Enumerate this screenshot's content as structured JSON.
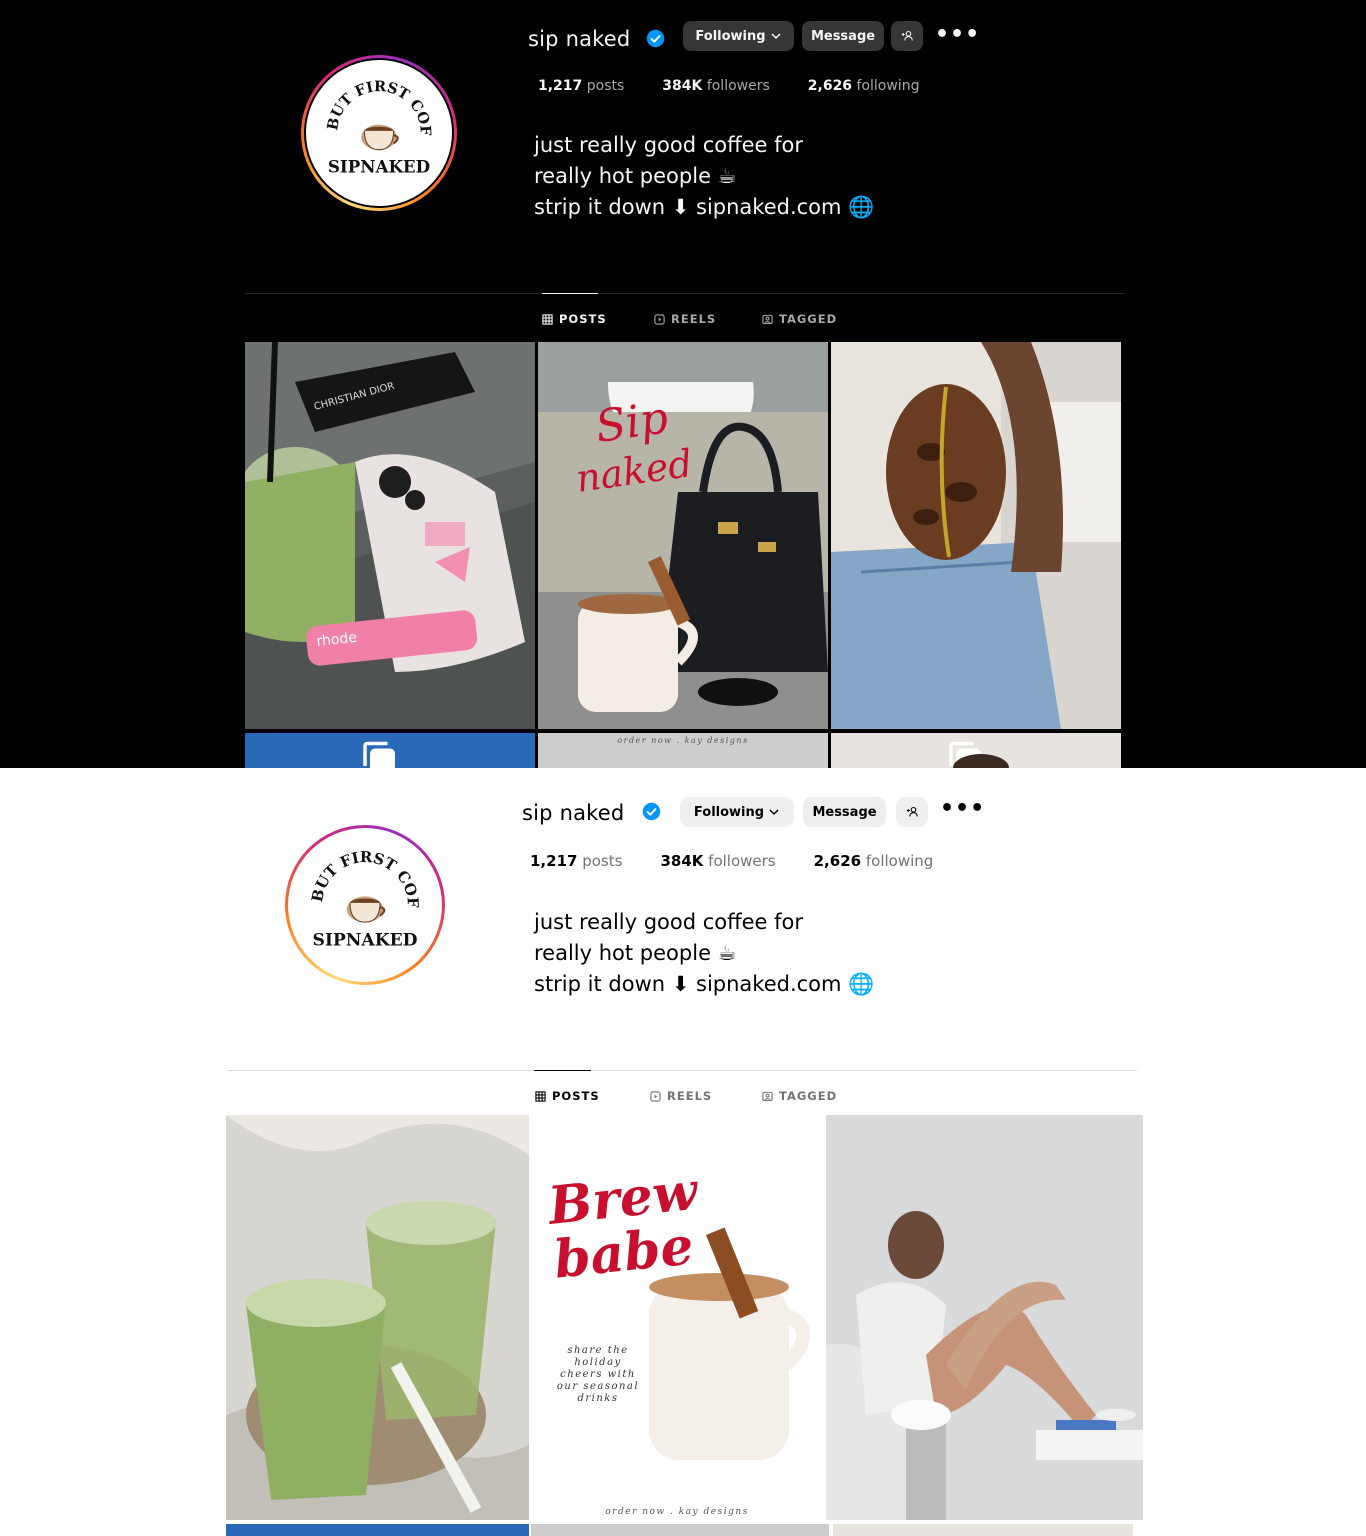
{
  "profile": {
    "username": "sip naked",
    "verified": true,
    "avatar_logo_text": "BUT FIRST COFFEE SIPNAKED",
    "buttons": {
      "following": "Following",
      "message": "Message",
      "add_user": "add-user-icon",
      "more": "•••"
    },
    "stats": {
      "posts_value": "1,217",
      "posts_label": "posts",
      "followers_value": "384K",
      "followers_label": "followers",
      "following_value": "2,626",
      "following_label": "following"
    },
    "bio": {
      "line1": "just really good coffee for",
      "line2": "really hot people ☕",
      "line3": "strip it down ⬇ sipnaked.com 🌐"
    }
  },
  "tabs": [
    {
      "label": "POSTS",
      "icon": "grid-icon",
      "active": true
    },
    {
      "label": "REELS",
      "icon": "reels-icon",
      "active": false
    },
    {
      "label": "TAGGED",
      "icon": "tagged-icon",
      "active": false
    }
  ],
  "dark_posts": [
    {
      "description": "matcha-phone-sunglasses",
      "caption": ""
    },
    {
      "description": "sip-naked-bag-coffee",
      "caption": "Sip naked"
    },
    {
      "description": "coffee-bean-jeans",
      "caption": ""
    }
  ],
  "dark_partial_row_caption": "order now . kay designs",
  "light_posts": [
    {
      "description": "two-matcha-drinks",
      "caption": ""
    },
    {
      "description": "brew-babe-promo",
      "caption": "Brew babe",
      "sub_caption": "share the holiday cheers with our seasonal drinks",
      "footer": "order now . kay designs"
    },
    {
      "description": "woman-drinking-coffee",
      "caption": ""
    }
  ],
  "colors": {
    "accent_blue": "#0095f6",
    "dark_bg": "#000000",
    "light_bg": "#ffffff",
    "script_red": "#c8102e"
  }
}
